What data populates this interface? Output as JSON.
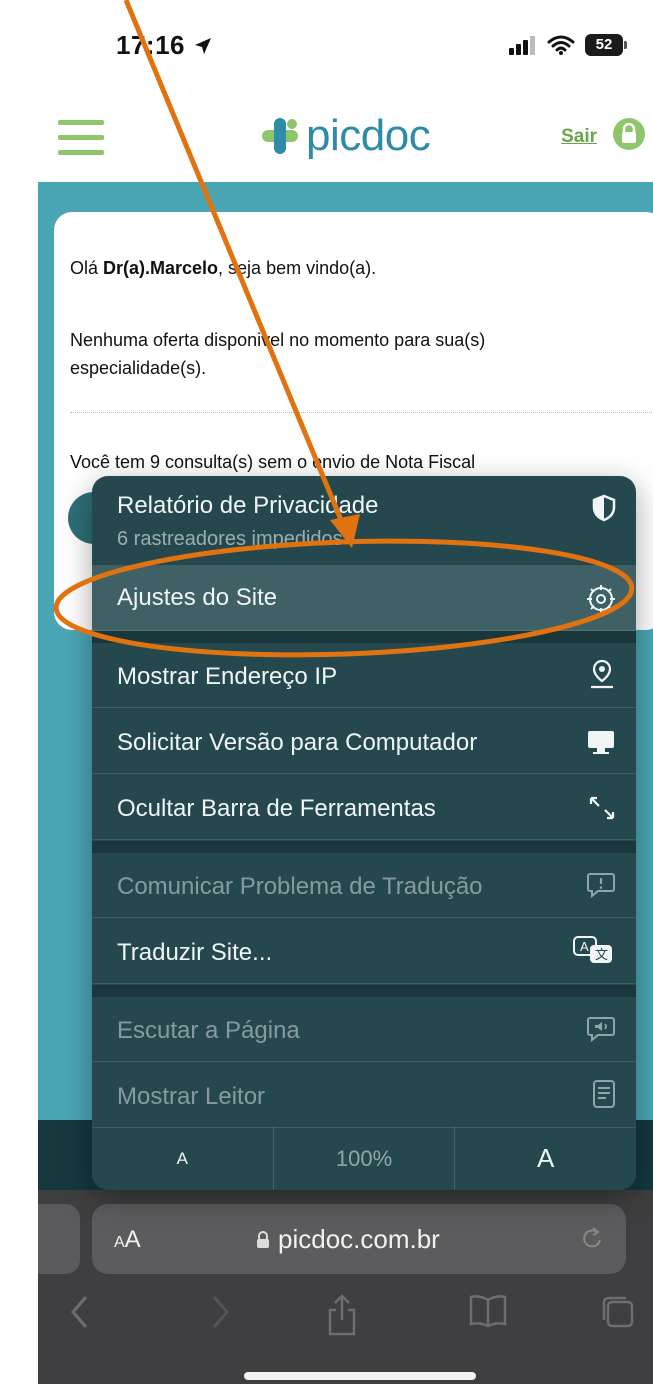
{
  "status_bar": {
    "time": "17:16",
    "battery": "52"
  },
  "header": {
    "logo_text": "picdoc",
    "logout_label": "Sair"
  },
  "card": {
    "greeting_prefix": "Olá ",
    "doctor_name": "Dr(a).Marcelo",
    "greeting_suffix": ", seja bem vindo(a).",
    "no_offer_text": "Nenhuma oferta disponivel no momento para sua(s) especialidade(s).",
    "invoice_text": "Você tem 9 consulta(s) sem o envio de Nota Fiscal"
  },
  "menu": {
    "privacy_report": {
      "label": "Relatório de Privacidade",
      "sublabel": "6 rastreadores impedidos",
      "icon": "shield-icon"
    },
    "site_settings": {
      "label": "Ajustes do Site",
      "icon": "gear-icon"
    },
    "show_ip": {
      "label": "Mostrar Endereço IP",
      "icon": "location-pin-icon"
    },
    "desktop_version": {
      "label": "Solicitar Versão para Computador",
      "icon": "desktop-icon"
    },
    "hide_toolbar": {
      "label": "Ocultar Barra de Ferramentas",
      "icon": "arrows-diagonal-icon"
    },
    "report_translation": {
      "label": "Comunicar Problema de Tradução",
      "icon": "exclamation-bubble-icon"
    },
    "translate_site": {
      "label": "Traduzir Site...",
      "icon": "translate-icon"
    },
    "listen_page": {
      "label": "Escutar a Página",
      "icon": "speaker-bubble-icon"
    },
    "show_reader": {
      "label": "Mostrar Leitor",
      "icon": "reader-icon"
    },
    "zoom": {
      "smaller": "A",
      "level": "100%",
      "larger": "A"
    }
  },
  "address_bar": {
    "aa_small": "A",
    "aa_large": "A",
    "url": "picdoc.com.br"
  },
  "colors": {
    "brand_teal": "#4aa6b5",
    "brand_green": "#8fc66b",
    "menu_bg": "#24484d",
    "annotation_orange": "#e07310"
  }
}
